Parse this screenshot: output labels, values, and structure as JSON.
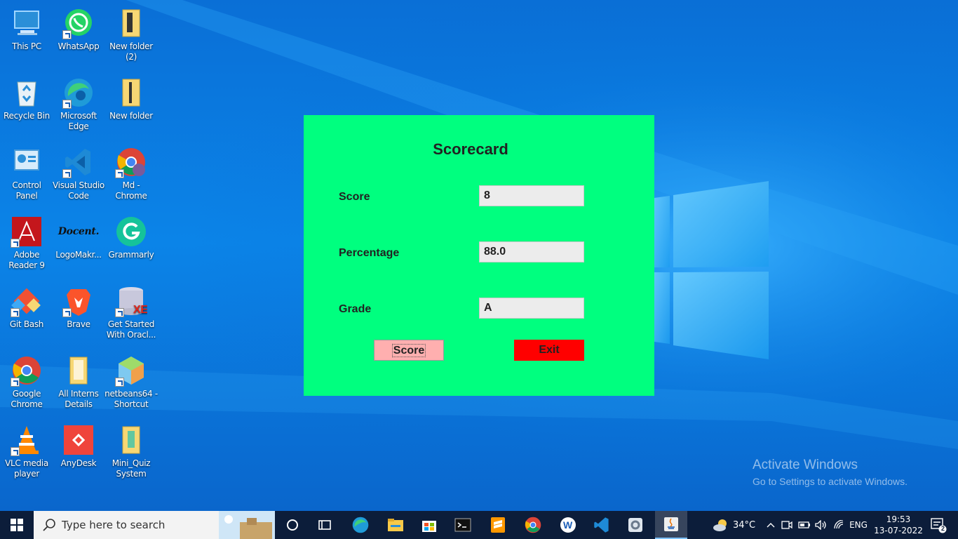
{
  "desktop": {
    "icons": [
      {
        "label": "This PC",
        "icon": "this-pc-icon"
      },
      {
        "label": "WhatsApp",
        "icon": "whatsapp-icon"
      },
      {
        "label": "New folder\n(2)",
        "icon": "folder-icon"
      },
      {
        "label": "Recycle Bin",
        "icon": "recycle-bin-icon"
      },
      {
        "label": "Microsoft\nEdge",
        "icon": "edge-icon"
      },
      {
        "label": "New folder",
        "icon": "folder-icon"
      },
      {
        "label": "Control\nPanel",
        "icon": "control-panel-icon"
      },
      {
        "label": "Visual Studio\nCode",
        "icon": "vscode-icon"
      },
      {
        "label": "Md -\nChrome",
        "icon": "chrome-icon"
      },
      {
        "label": "Adobe\nReader 9",
        "icon": "adobe-reader-icon"
      },
      {
        "label": "LogoMakr...",
        "icon": "logomakr-icon"
      },
      {
        "label": "Grammarly",
        "icon": "grammarly-icon"
      },
      {
        "label": "Git Bash",
        "icon": "git-bash-icon"
      },
      {
        "label": "Brave",
        "icon": "brave-icon"
      },
      {
        "label": "Get Started\nWith Oracl...",
        "icon": "oracle-db-icon"
      },
      {
        "label": "Google\nChrome",
        "icon": "chrome-icon"
      },
      {
        "label": "All Interns\nDetails",
        "icon": "folder-icon"
      },
      {
        "label": "netbeans64 -\nShortcut",
        "icon": "netbeans-icon"
      },
      {
        "label": "VLC media\nplayer",
        "icon": "vlc-icon"
      },
      {
        "label": "AnyDesk",
        "icon": "anydesk-icon"
      },
      {
        "label": "Mini_Quiz\nSystem",
        "icon": "folder-icon"
      }
    ],
    "logomakr_text": "Docent."
  },
  "scorecard": {
    "title": "Scorecard",
    "score_label": "Score",
    "score_value": "8",
    "percentage_label": "Percentage",
    "percentage_value": "88.0",
    "grade_label": "Grade",
    "grade_value": "A",
    "score_button": "Score",
    "exit_button": "Exit",
    "colors": {
      "background": "#00ff7f",
      "score_button": "#ffafaf",
      "exit_button": "#ff0000"
    }
  },
  "watermark": {
    "line1": "Activate Windows",
    "line2": "Go to Settings to activate Windows."
  },
  "taskbar": {
    "search_placeholder": "Type here to search",
    "apps": [
      "cortana-icon",
      "task-view-icon",
      "edge-icon",
      "file-explorer-icon",
      "microsoft-store-icon",
      "terminal-icon",
      "sublime-text-icon",
      "chrome-icon",
      "word-icon",
      "vscode-icon",
      "settings-app-icon",
      "java-icon"
    ],
    "weather": "34°C",
    "language": "ENG",
    "time": "19:53",
    "date": "13-07-2022",
    "notification_count": "2"
  }
}
